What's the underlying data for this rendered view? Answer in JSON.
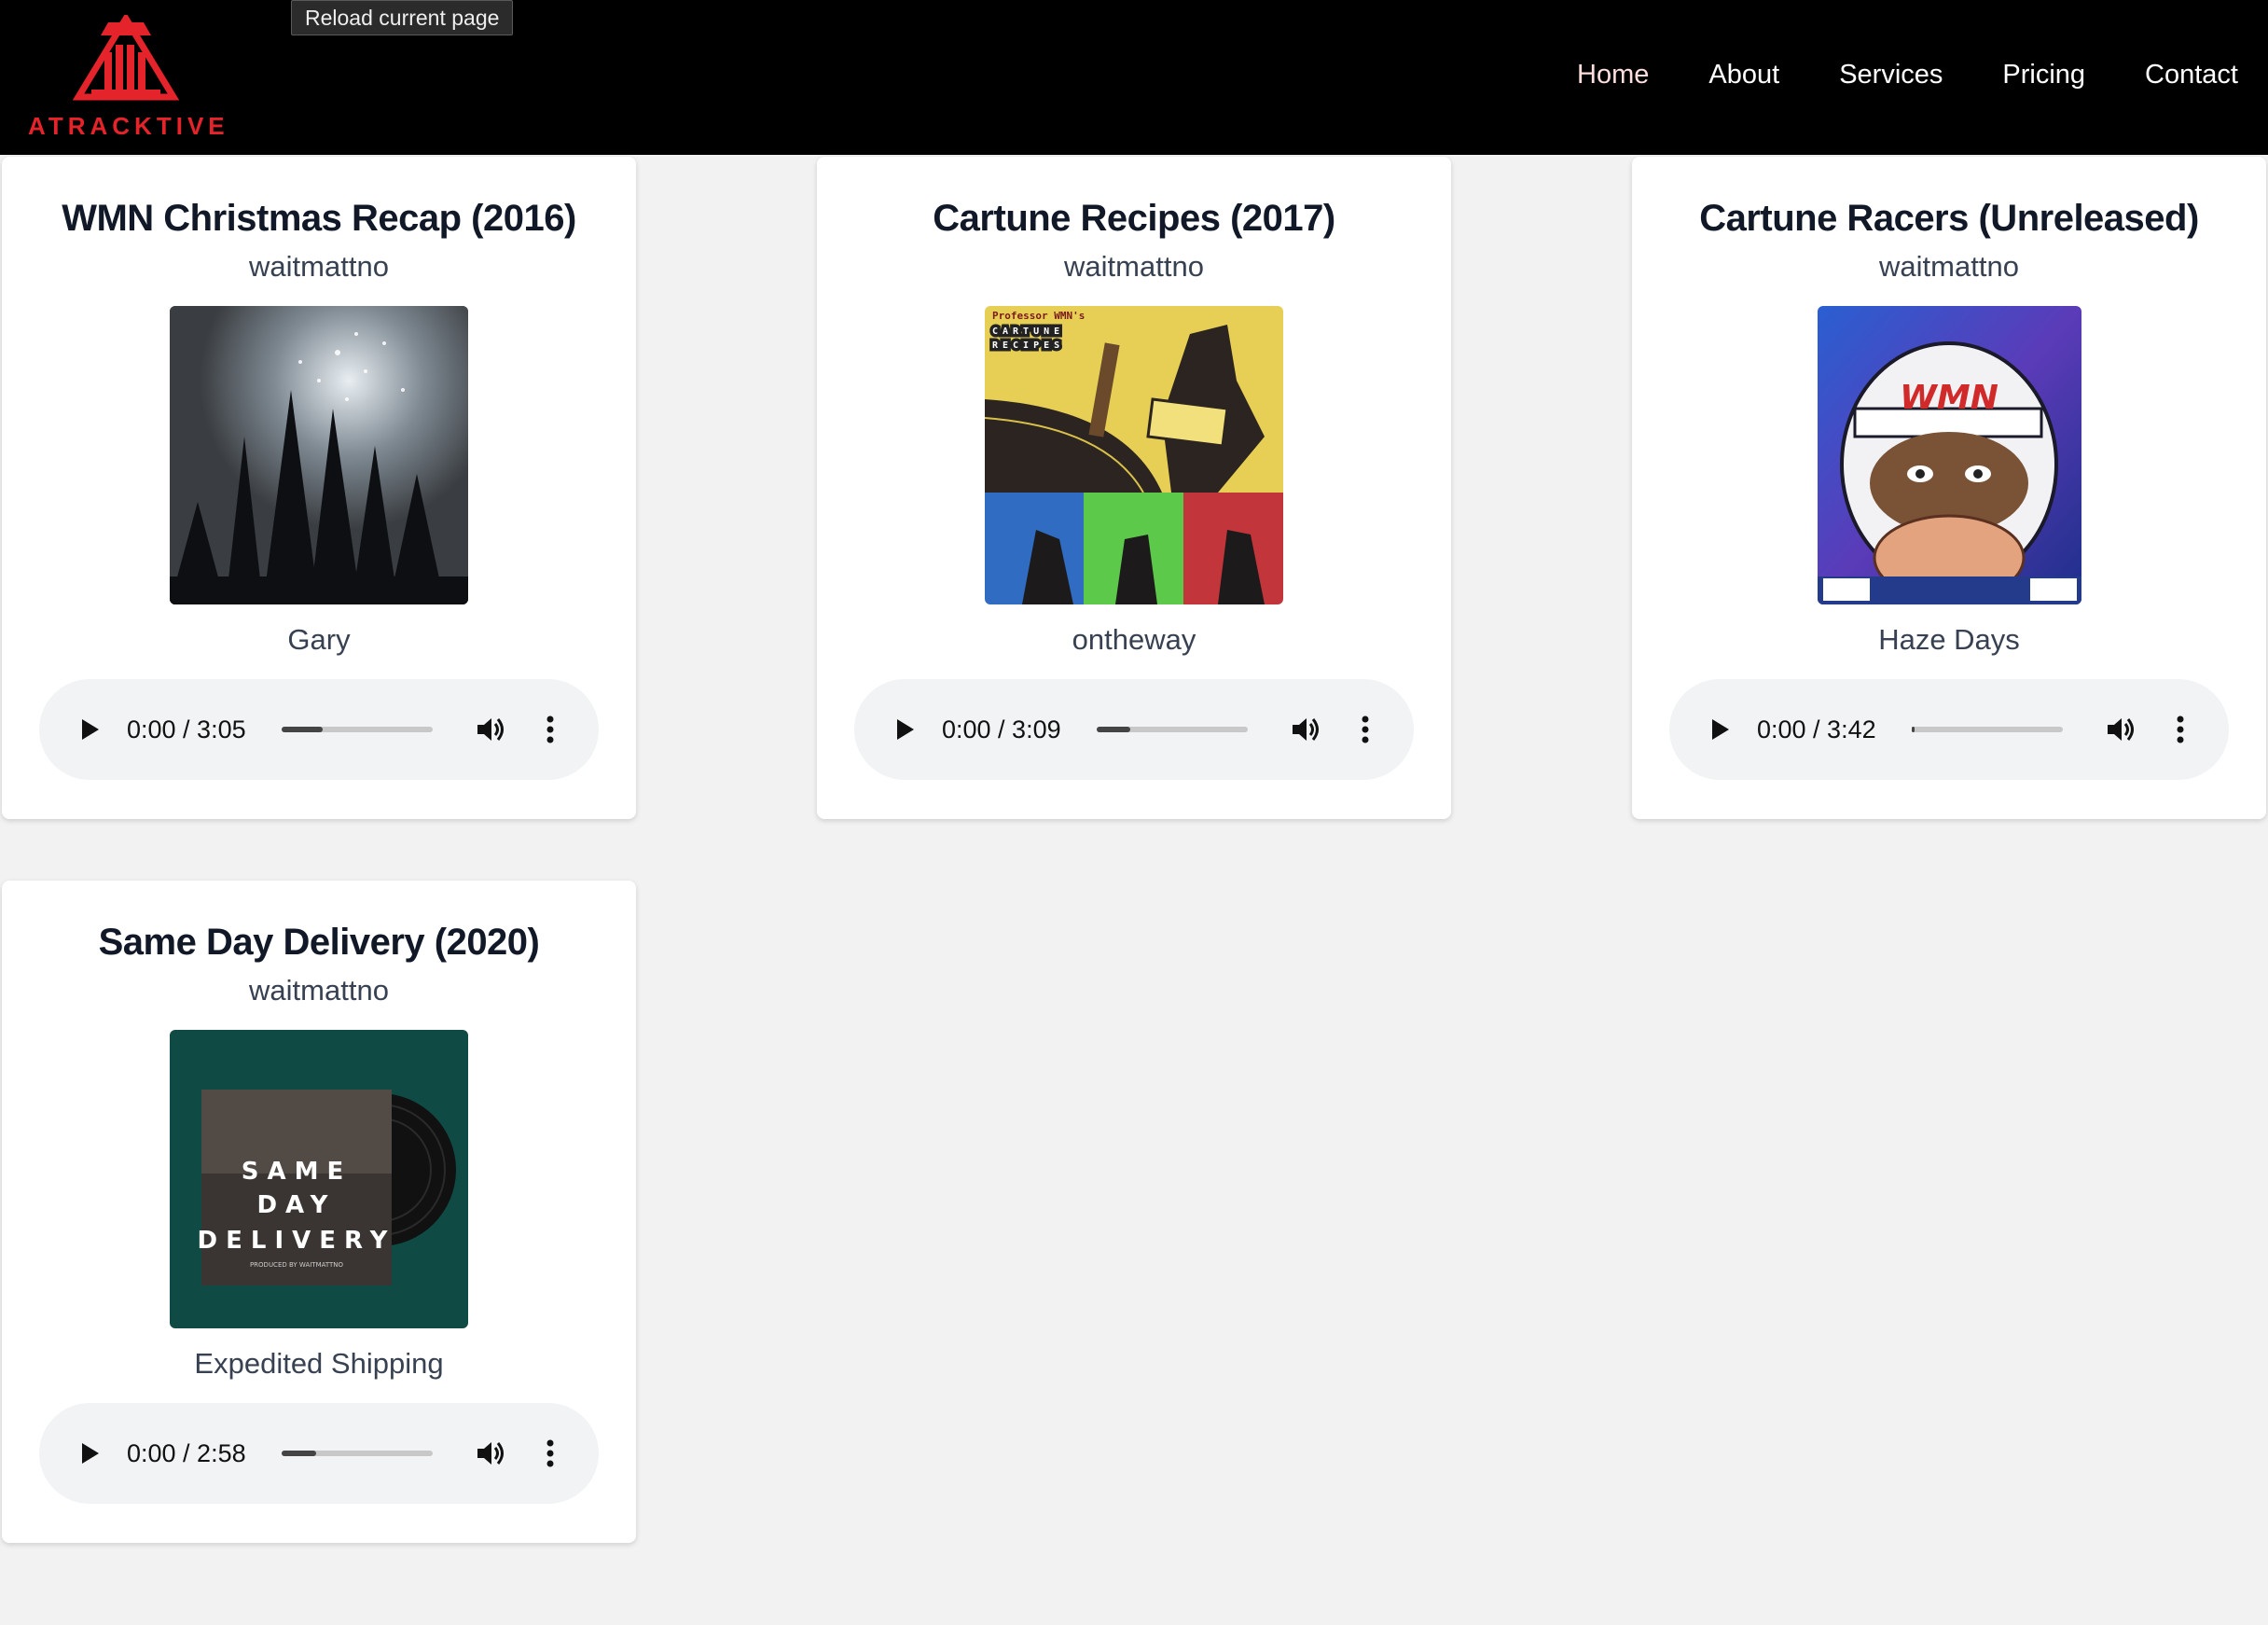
{
  "header": {
    "brand": "ATRACKTIVE",
    "tooltip": "Reload current page",
    "nav": [
      {
        "label": "Home",
        "active": true
      },
      {
        "label": "About"
      },
      {
        "label": "Services"
      },
      {
        "label": "Pricing"
      },
      {
        "label": "Contact"
      }
    ]
  },
  "cards": [
    {
      "title": "WMN Christmas Recap (2016)",
      "artist": "waitmattno",
      "track": "Gary",
      "time": "0:00 / 3:05",
      "buffered": 0.27
    },
    {
      "title": "Cartune Recipes (2017)",
      "artist": "waitmattno",
      "track": "ontheway",
      "time": "0:00 / 3:09",
      "buffered": 0.22
    },
    {
      "title": "Cartune Racers (Unreleased)",
      "artist": "waitmattno",
      "track": "Haze Days",
      "time": "0:00 / 3:42",
      "buffered": 0.02
    },
    {
      "title": "Same Day Delivery (2020)",
      "artist": "waitmattno",
      "track": "Expedited Shipping",
      "time": "0:00 / 2:58",
      "buffered": 0.23
    }
  ],
  "covers": {
    "same_day_lines": [
      "SAME",
      "DAY",
      "DELIVERY"
    ],
    "same_day_credit": "PRODUCED BY WAITMATTNO",
    "cartune_recipes_header": "Professor WMN's",
    "cartune_recipes_grid": [
      "CARTUNE",
      "RECIPES"
    ],
    "cartune_racers_helmet": "WMN"
  },
  "colors": {
    "brand_red": "#e5232a",
    "header_bg": "#000000",
    "page_bg": "#f2f2f2"
  }
}
